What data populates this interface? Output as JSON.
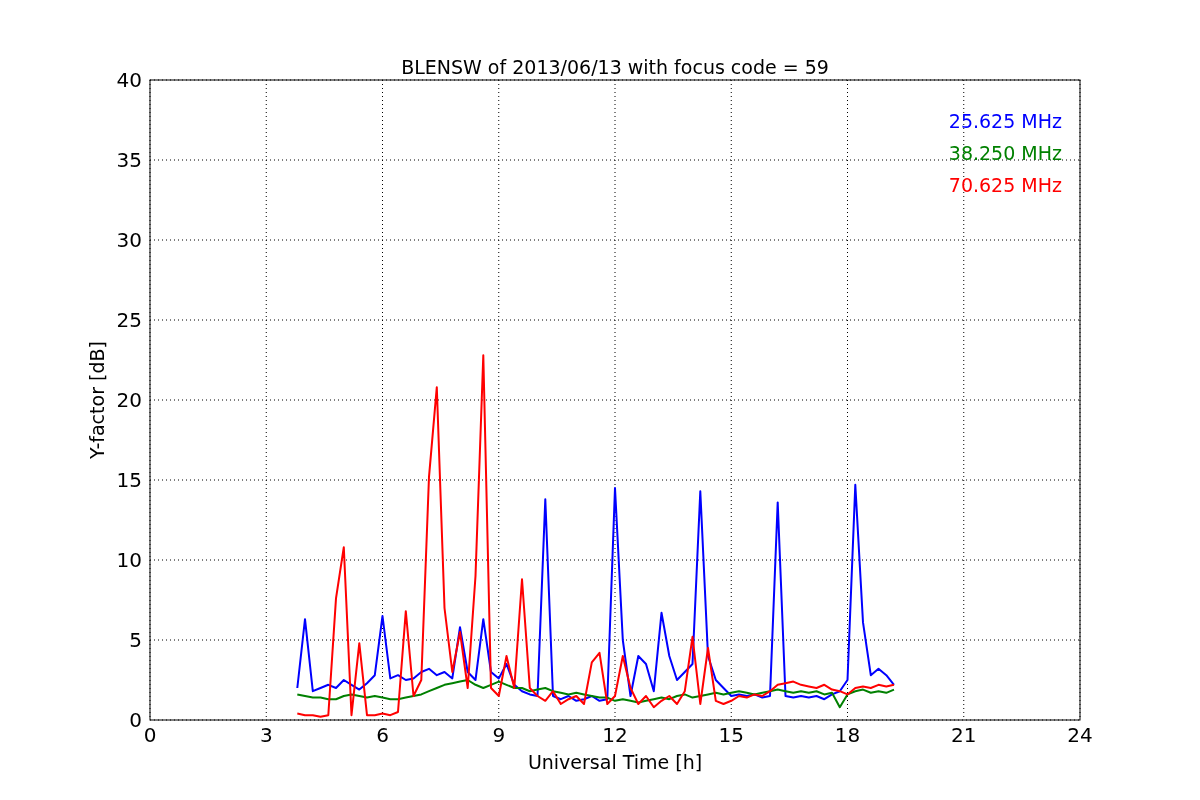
{
  "chart_data": {
    "type": "line",
    "grid": true,
    "title": "BLENSW of 2013/06/13 with focus code = 59",
    "xlabel": "Universal Time [h]",
    "ylabel": "Y-factor [dB]",
    "xlim": [
      0,
      24
    ],
    "ylim": [
      0,
      40
    ],
    "xticks": [
      0,
      3,
      6,
      9,
      12,
      15,
      18,
      21,
      24
    ],
    "yticks": [
      0,
      5,
      10,
      15,
      20,
      25,
      30,
      35,
      40
    ],
    "x": [
      3.8,
      4.0,
      4.2,
      4.4,
      4.6,
      4.8,
      5.0,
      5.2,
      5.4,
      5.6,
      5.8,
      6.0,
      6.2,
      6.4,
      6.6,
      6.8,
      7.0,
      7.2,
      7.4,
      7.6,
      7.8,
      8.0,
      8.2,
      8.4,
      8.6,
      8.8,
      9.0,
      9.2,
      9.4,
      9.6,
      9.8,
      10.0,
      10.2,
      10.4,
      10.6,
      10.8,
      11.0,
      11.2,
      11.4,
      11.6,
      11.8,
      12.0,
      12.2,
      12.4,
      12.6,
      12.8,
      13.0,
      13.2,
      13.4,
      13.6,
      13.8,
      14.0,
      14.2,
      14.4,
      14.6,
      14.8,
      15.0,
      15.2,
      15.4,
      15.6,
      15.8,
      16.0,
      16.2,
      16.4,
      16.6,
      16.8,
      17.0,
      17.2,
      17.4,
      17.6,
      17.8,
      18.0,
      18.2,
      18.4,
      18.6,
      18.8,
      19.0,
      19.2
    ],
    "series": [
      {
        "name": "25.625 MHz",
        "color": "#0000ff",
        "values": [
          2.0,
          6.3,
          1.8,
          2.0,
          2.2,
          2.0,
          2.5,
          2.2,
          1.9,
          2.3,
          2.8,
          6.5,
          2.6,
          2.8,
          2.5,
          2.6,
          3.0,
          3.2,
          2.8,
          3.0,
          2.6,
          5.8,
          3.0,
          2.5,
          6.3,
          3.0,
          2.6,
          3.5,
          2.2,
          1.8,
          1.6,
          1.5,
          13.8,
          1.5,
          1.3,
          1.5,
          1.2,
          1.3,
          1.5,
          1.2,
          1.3,
          14.5,
          5.0,
          1.5,
          4.0,
          3.5,
          1.8,
          6.7,
          4.0,
          2.5,
          3.0,
          3.5,
          14.3,
          4.0,
          2.5,
          2.0,
          1.5,
          1.6,
          1.5,
          1.6,
          1.4,
          1.5,
          13.6,
          1.5,
          1.4,
          1.5,
          1.4,
          1.5,
          1.3,
          1.6,
          1.8,
          2.5,
          14.7,
          6.1,
          2.8,
          3.2,
          2.8,
          2.2
        ]
      },
      {
        "name": "38.250 MHz",
        "color": "#008000",
        "values": [
          1.6,
          1.5,
          1.4,
          1.4,
          1.3,
          1.3,
          1.5,
          1.6,
          1.5,
          1.4,
          1.5,
          1.4,
          1.3,
          1.3,
          1.4,
          1.5,
          1.6,
          1.8,
          2.0,
          2.2,
          2.3,
          2.4,
          2.5,
          2.2,
          2.0,
          2.2,
          2.4,
          2.2,
          2.0,
          2.0,
          1.8,
          1.9,
          2.0,
          1.8,
          1.7,
          1.6,
          1.7,
          1.6,
          1.5,
          1.4,
          1.4,
          1.2,
          1.3,
          1.2,
          1.1,
          1.2,
          1.3,
          1.4,
          1.3,
          1.5,
          1.6,
          1.4,
          1.5,
          1.6,
          1.7,
          1.6,
          1.7,
          1.8,
          1.7,
          1.6,
          1.7,
          1.8,
          1.9,
          1.8,
          1.7,
          1.8,
          1.7,
          1.8,
          1.6,
          1.7,
          0.8,
          1.6,
          1.8,
          1.9,
          1.7,
          1.8,
          1.7,
          1.9
        ]
      },
      {
        "name": "70.625 MHz",
        "color": "#ff0000",
        "values": [
          0.4,
          0.3,
          0.3,
          0.2,
          0.3,
          7.6,
          10.8,
          0.3,
          4.8,
          0.3,
          0.3,
          0.4,
          0.3,
          0.5,
          6.8,
          1.5,
          2.5,
          15.2,
          20.8,
          7.0,
          3.0,
          5.5,
          2.0,
          9.0,
          22.8,
          2.0,
          1.5,
          4.0,
          2.0,
          8.8,
          2.0,
          1.5,
          1.2,
          1.8,
          1.0,
          1.3,
          1.5,
          1.0,
          3.6,
          4.2,
          1.0,
          1.5,
          4.0,
          2.0,
          1.0,
          1.5,
          0.8,
          1.2,
          1.5,
          1.0,
          1.8,
          5.2,
          1.0,
          4.5,
          1.2,
          1.0,
          1.2,
          1.5,
          1.4,
          1.6,
          1.5,
          1.8,
          2.2,
          2.3,
          2.4,
          2.2,
          2.1,
          2.0,
          2.2,
          1.9,
          1.8,
          1.6,
          2.0,
          2.1,
          2.0,
          2.2,
          2.1,
          2.2
        ]
      }
    ]
  }
}
